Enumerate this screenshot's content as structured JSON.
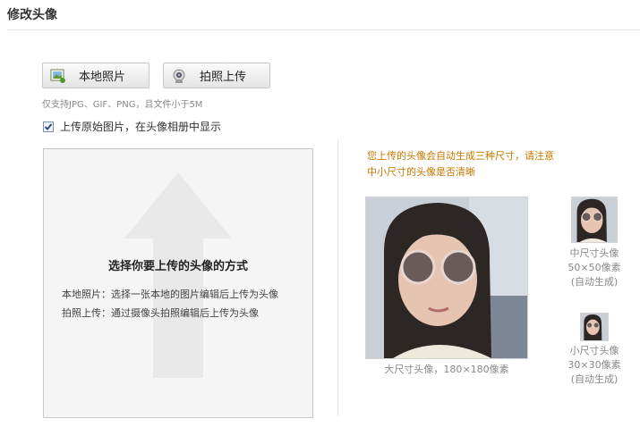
{
  "header": {
    "title": "修改头像"
  },
  "upload": {
    "local_button": "本地照片",
    "camera_button": "拍照上传",
    "hint": "仅支持JPG、GIF、PNG，且文件小于5M",
    "keep_original": {
      "checked": true,
      "label": "上传原始图片，在头像相册中显示"
    }
  },
  "drop_area": {
    "title": "选择你要上传的头像的方式",
    "line1": "本地照片：选择一张本地的图片编辑后上传为头像",
    "line2": "拍照上传：通过摄像头拍照编辑后上传为头像"
  },
  "preview": {
    "notice_line1": "您上传的头像会自动生成三种尺寸，请注意",
    "notice_line2": "中小尺寸的头像是否清晰",
    "large_caption": "大尺寸头像，180×180像素",
    "medium": {
      "name": "中尺寸头像",
      "size": "50×50像素",
      "note": "(自动生成)"
    },
    "small": {
      "name": "小尺寸头像",
      "size": "30×30像素",
      "note": "(自动生成)"
    }
  },
  "colors": {
    "notice": "#c87800",
    "caption": "#888888",
    "arrow": "#e9e9e9"
  }
}
